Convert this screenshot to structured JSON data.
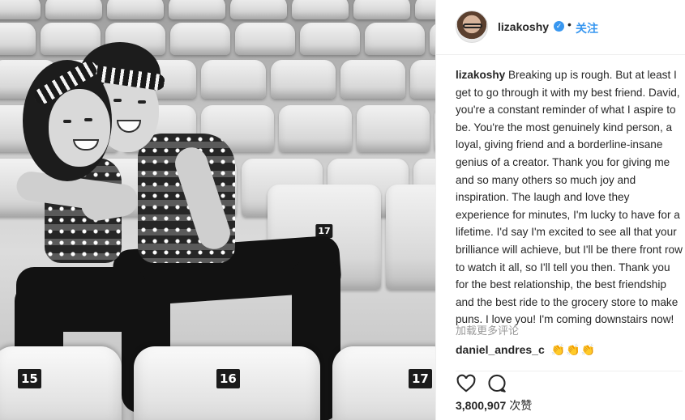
{
  "post": {
    "username": "lizakoshy",
    "verified_badge": "✓",
    "separator": "•",
    "follow_label": "关注"
  },
  "photo": {
    "seat_numbers": [
      "15",
      "16",
      "17",
      "17"
    ]
  },
  "caption": {
    "username": "lizakoshy",
    "text": "Breaking up is rough. But at least I get to go through it with my best friend. David, you're a constant reminder of what I aspire to be. You're the most genuinely kind person, a loyal, giving friend and a borderline-insane genius of a creator. Thank you for giving me and so many others so much joy and inspiration. The laugh and love they experience for minutes, I'm lucky to have for a lifetime. I'd say I'm excited to see all that your brilliance will achieve, but I'll be there front row to watch it all, so I'll tell you then. Thank you for the best relationship, the best friendship and the best ride to the grocery store to make puns. I love you! I'm coming downstairs now!"
  },
  "comments": {
    "load_more_label": "加载更多评论",
    "items": [
      {
        "username": "daniel_andres_c",
        "text": "👏👏👏"
      }
    ]
  },
  "actions": {
    "like_icon": "heart-icon",
    "comment_icon": "comment-icon"
  },
  "likes": {
    "count": "3,800,907",
    "unit": "次赞"
  },
  "colors": {
    "accent": "#3897f0",
    "text": "#262626",
    "muted": "#999999"
  }
}
